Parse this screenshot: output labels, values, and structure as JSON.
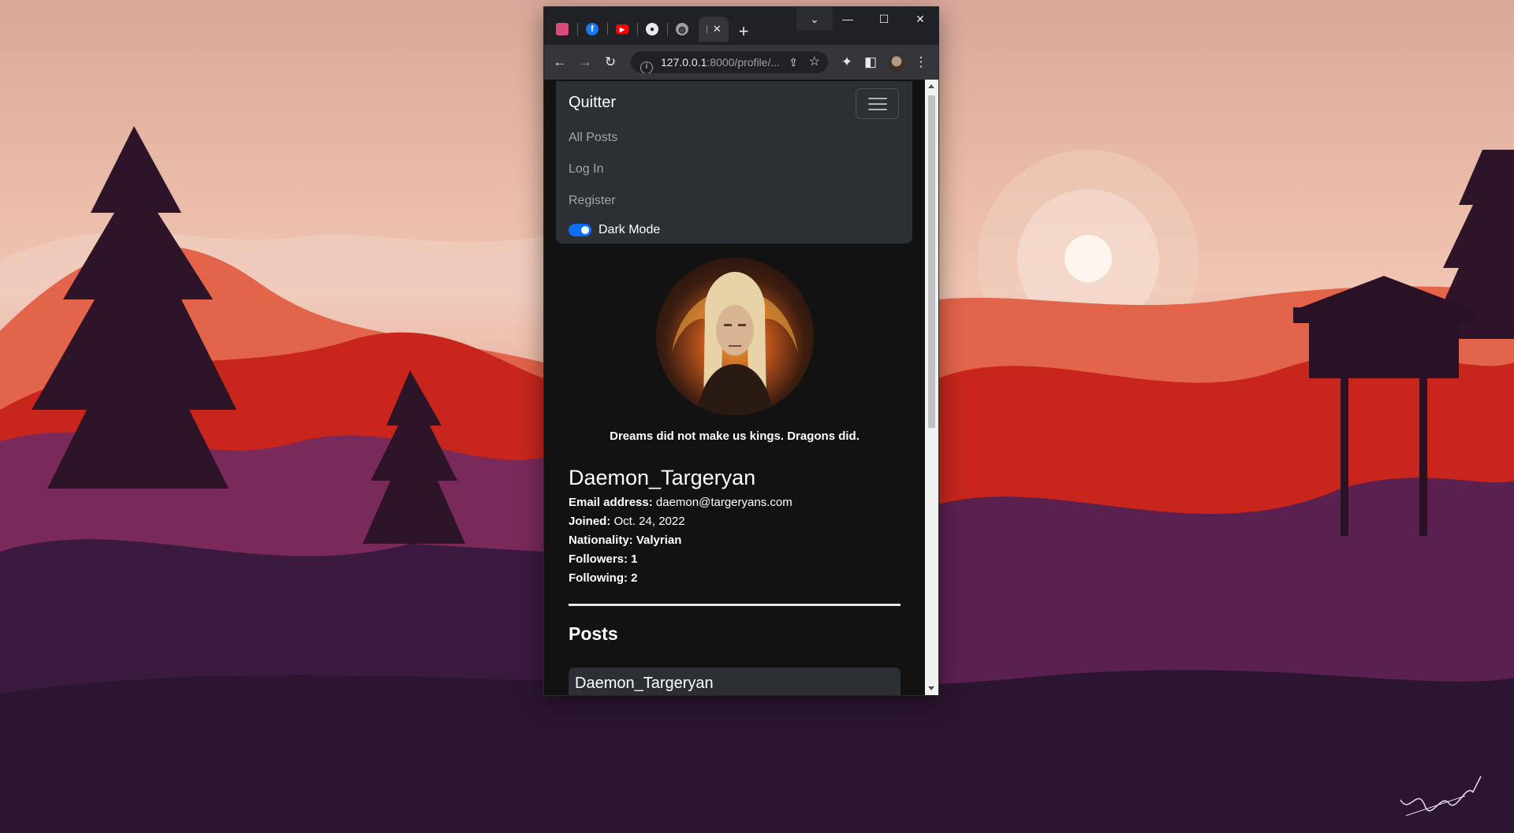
{
  "browser": {
    "tabs": [
      {
        "icon": "site-favicon-icon"
      },
      {
        "icon": "facebook-icon"
      },
      {
        "icon": "youtube-icon"
      },
      {
        "icon": "github-icon"
      },
      {
        "icon": "globe-icon"
      },
      {
        "icon": "loading-icon",
        "active": true
      }
    ],
    "address": {
      "host": "127.0.0.1",
      "path": ":8000/profile/..."
    }
  },
  "navbar": {
    "brand": "Quitter",
    "links": [
      "All Posts",
      "Log In",
      "Register"
    ],
    "dark_mode_label": "Dark Mode",
    "dark_mode_on": true
  },
  "profile": {
    "quote": "Dreams did not make us kings. Dragons did.",
    "username": "Daemon_Targeryan",
    "email_label": "Email address:",
    "email": "daemon@targeryans.com",
    "joined_label": "Joined:",
    "joined": "Oct. 24, 2022",
    "nationality": "Nationality: Valyrian",
    "followers": "Followers: 1",
    "following": "Following: 2"
  },
  "posts": {
    "title": "Posts",
    "items": [
      {
        "author": "Daemon_Targeryan"
      }
    ]
  },
  "colors": {
    "accent": "#0d6efd",
    "navbar": "#2b3035",
    "page_bg": "#121212"
  }
}
